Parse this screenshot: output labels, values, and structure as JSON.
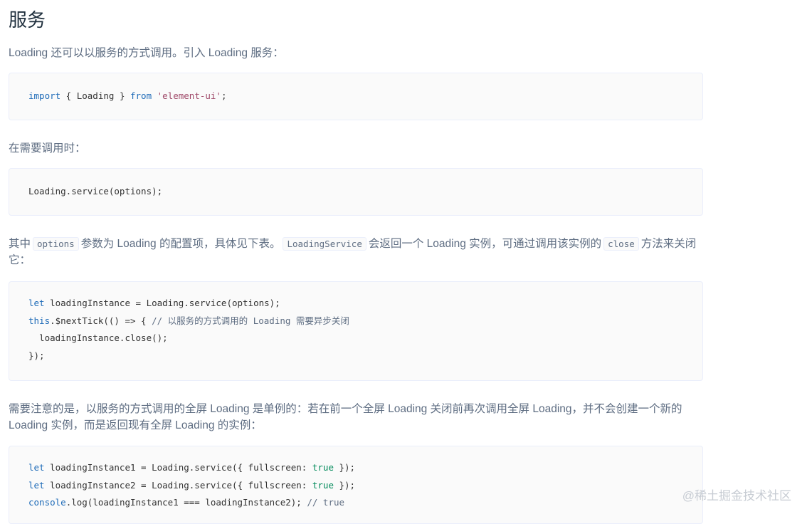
{
  "heading": "服务",
  "intro": "Loading 还可以以服务的方式调用。引入 Loading 服务：",
  "code1": {
    "kw_import": "import",
    "mid": " { Loading } ",
    "kw_from": "from",
    "space": " ",
    "str": "'element-ui'",
    "end": ";"
  },
  "when_needed": "在需要调用时：",
  "code2": "Loading.service(options);",
  "options_para": {
    "t1": "其中",
    "c1": "options",
    "t2": "参数为 Loading 的配置项，具体见下表。",
    "c2": "LoadingService",
    "t3": "会返回一个 Loading 实例，可通过调用该实例的",
    "c3": "close",
    "t4": "方法来关闭它："
  },
  "code3": {
    "l1_kw": "let",
    "l1_rest": " loadingInstance = Loading.service(options);",
    "l2_kw": "this",
    "l2_rest": ".$nextTick(() => { ",
    "l2_cmt": "// 以服务的方式调用的 Loading 需要异步关闭",
    "l3": "  loadingInstance.close();",
    "l4": "});"
  },
  "singleton_para": "需要注意的是，以服务的方式调用的全屏 Loading 是单例的：若在前一个全屏 Loading 关闭前再次调用全屏 Loading，并不会创建一个新的 Loading 实例，而是返回现有全屏 Loading 的实例：",
  "code4": {
    "l1_kw": "let",
    "l1_a": " loadingInstance1 = Loading.service({ fullscreen: ",
    "l1_bool": "true",
    "l1_b": " });",
    "l2_kw": "let",
    "l2_a": " loadingInstance2 = Loading.service({ fullscreen: ",
    "l2_bool": "true",
    "l2_b": " });",
    "l3_kw": "console",
    "l3_a": ".log(loadingInstance1 === loadingInstance2); ",
    "l3_cmt": "// true"
  },
  "watermark": "@稀土掘金技术社区"
}
